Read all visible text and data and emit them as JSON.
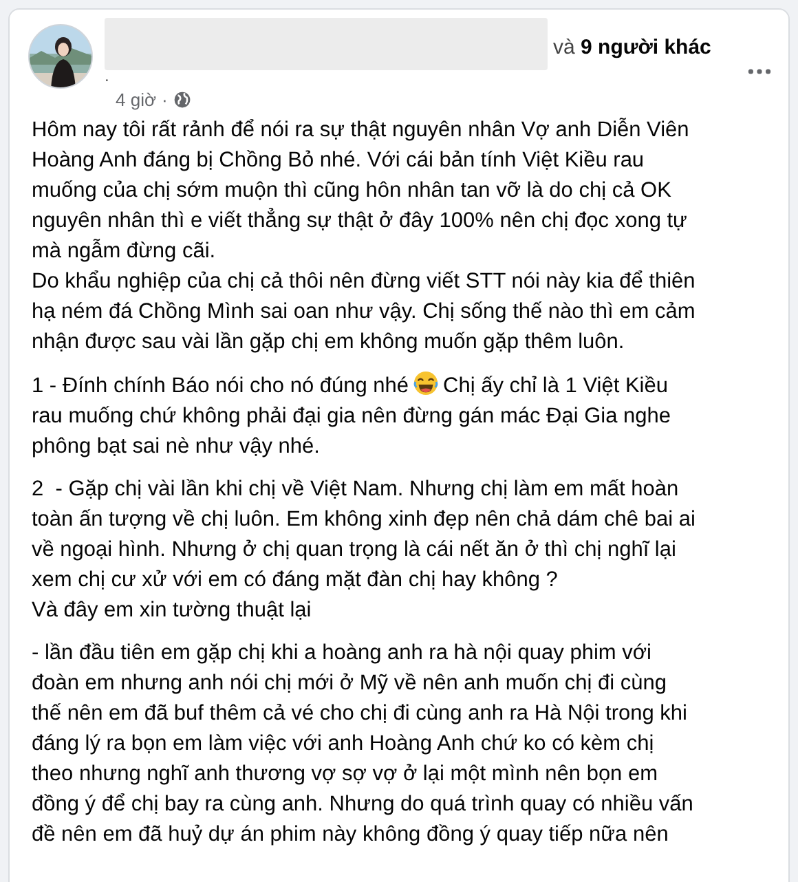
{
  "post": {
    "tagged_prefix": "và",
    "tagged_others": "9 người khác",
    "name_dot": ".",
    "time": "4 giờ",
    "time_separator": "·",
    "paragraphs": [
      {
        "kind": "text",
        "lines": [
          "Hôm nay tôi rất rảnh để nói ra sự thật nguyên nhân Vợ anh Diễn Viên",
          "Hoàng Anh đáng bị Chồng Bỏ nhé. Với cái bản tính Việt Kiều rau",
          "muống của chị sớm muộn thì cũng hôn nhân tan vỡ là do chị cả OK",
          "nguyên nhân thì e viết thẳng sự thật ở đây 100% nên chị đọc xong tự",
          "mà ngẫm đừng cãi.",
          "Do khẩu nghiệp của chị cả thôi nên đừng viết STT nói này kia để thiên",
          "hạ ném đá Chồng Mình sai oan như vậy. Chị sống thế nào thì em cảm",
          "nhận được sau vài lần gặp chị em không muốn gặp thêm luôn."
        ]
      },
      {
        "kind": "emoji",
        "lead": "1 - Đính chính Báo nói cho nó đúng nhé",
        "lines": [
          "Chị ấy chỉ là 1 Việt Kiều",
          "rau muống chứ không phải đại gia nên đừng gán mác Đại Gia nghe",
          "phông bạt sai nè như vậy nhé."
        ]
      },
      {
        "kind": "text",
        "lines": [
          "2  - Gặp chị vài lần khi chị về Việt Nam. Nhưng chị làm em mất hoàn",
          "toàn ấn tượng về chị luôn. Em không xinh đẹp nên chả dám chê bai ai",
          "về ngoại hình. Nhưng ở chị quan trọng là cái nết ăn ở thì chị nghĩ lại",
          "xem chị cư xử với em có đáng mặt đàn chị hay không ?",
          "Và đây em xin tường thuật lại"
        ]
      },
      {
        "kind": "text",
        "lines": [
          "- lần đầu tiên em gặp chị khi a hoàng anh ra hà nội quay phim với",
          "đoàn em nhưng anh nói chị mới ở Mỹ về nên anh muốn chị đi cùng",
          "thế nên em đã buf thêm cả vé cho chị đi cùng anh ra Hà Nội trong khi",
          "đáng lý ra bọn em làm việc với anh Hoàng Anh chứ ko có kèm chị",
          "theo nhưng nghĩ anh thương vợ sợ vợ ở lại một mình nên bọn em",
          "đồng ý để chị bay ra cùng anh. Nhưng do quá trình quay có nhiều vấn",
          "đề nên em đã huỷ dự án phim này không đồng ý quay tiếp nữa nên"
        ]
      }
    ]
  }
}
